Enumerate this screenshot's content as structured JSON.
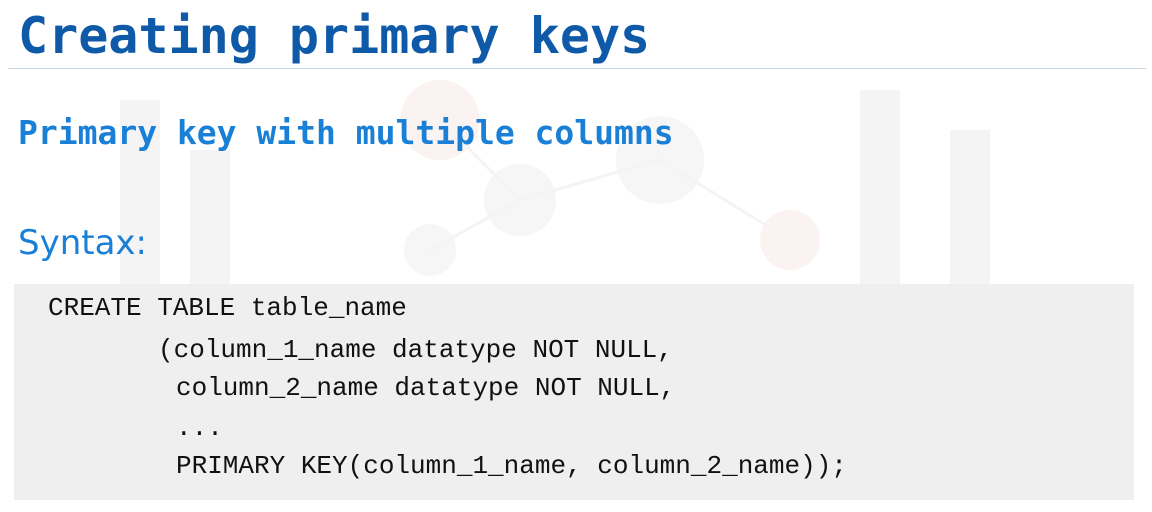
{
  "slide": {
    "title": "Creating primary keys",
    "subtitle": "Primary key with multiple columns",
    "syntax_label": "Syntax:",
    "code_lines": [
      "CREATE TABLE table_name",
      "(column_1_name datatype NOT NULL,",
      "column_2_name datatype NOT NULL,",
      "...",
      "PRIMARY KEY(column_1_name, column_2_name));"
    ]
  },
  "colors": {
    "title": "#0f5aa8",
    "accent": "#1a7fd6",
    "code_background": "#efefef",
    "code_text": "#111111"
  }
}
